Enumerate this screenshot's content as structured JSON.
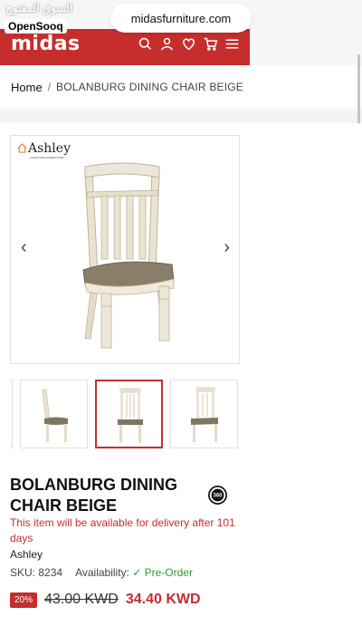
{
  "browser": {
    "url": "midasfurniture.com"
  },
  "watermark": {
    "arabic": "السوق المفتوح",
    "latin": "OpenSooq"
  },
  "header": {
    "logo": "midas",
    "icons": [
      "search-icon",
      "user-icon",
      "heart-icon",
      "cart-icon",
      "menu-icon"
    ],
    "brand_color": "#c62d2d"
  },
  "breadcrumb": {
    "home": "Home",
    "separator": "/",
    "current": "BOLANBURG DINING CHAIR BEIGE"
  },
  "gallery": {
    "brand_logo": "Ashley",
    "brand_logo_sub": "FURNITURE HOMESTORE",
    "prev_icon": "chevron-left-icon",
    "next_icon": "chevron-right-icon",
    "thumbnail_count": 3,
    "active_thumbnail": 2
  },
  "product": {
    "title": "BOLANBURG DINING CHAIR BEIGE",
    "badge_360": "360",
    "delivery_note": "This item will be available for delivery after 101 days",
    "brand": "Ashley",
    "sku_label": "SKU:",
    "sku": "8234",
    "availability_label": "Availability:",
    "availability": "Pre-Order",
    "discount": "20%",
    "old_price": "43.00 KWD",
    "new_price": "34.40 KWD"
  }
}
